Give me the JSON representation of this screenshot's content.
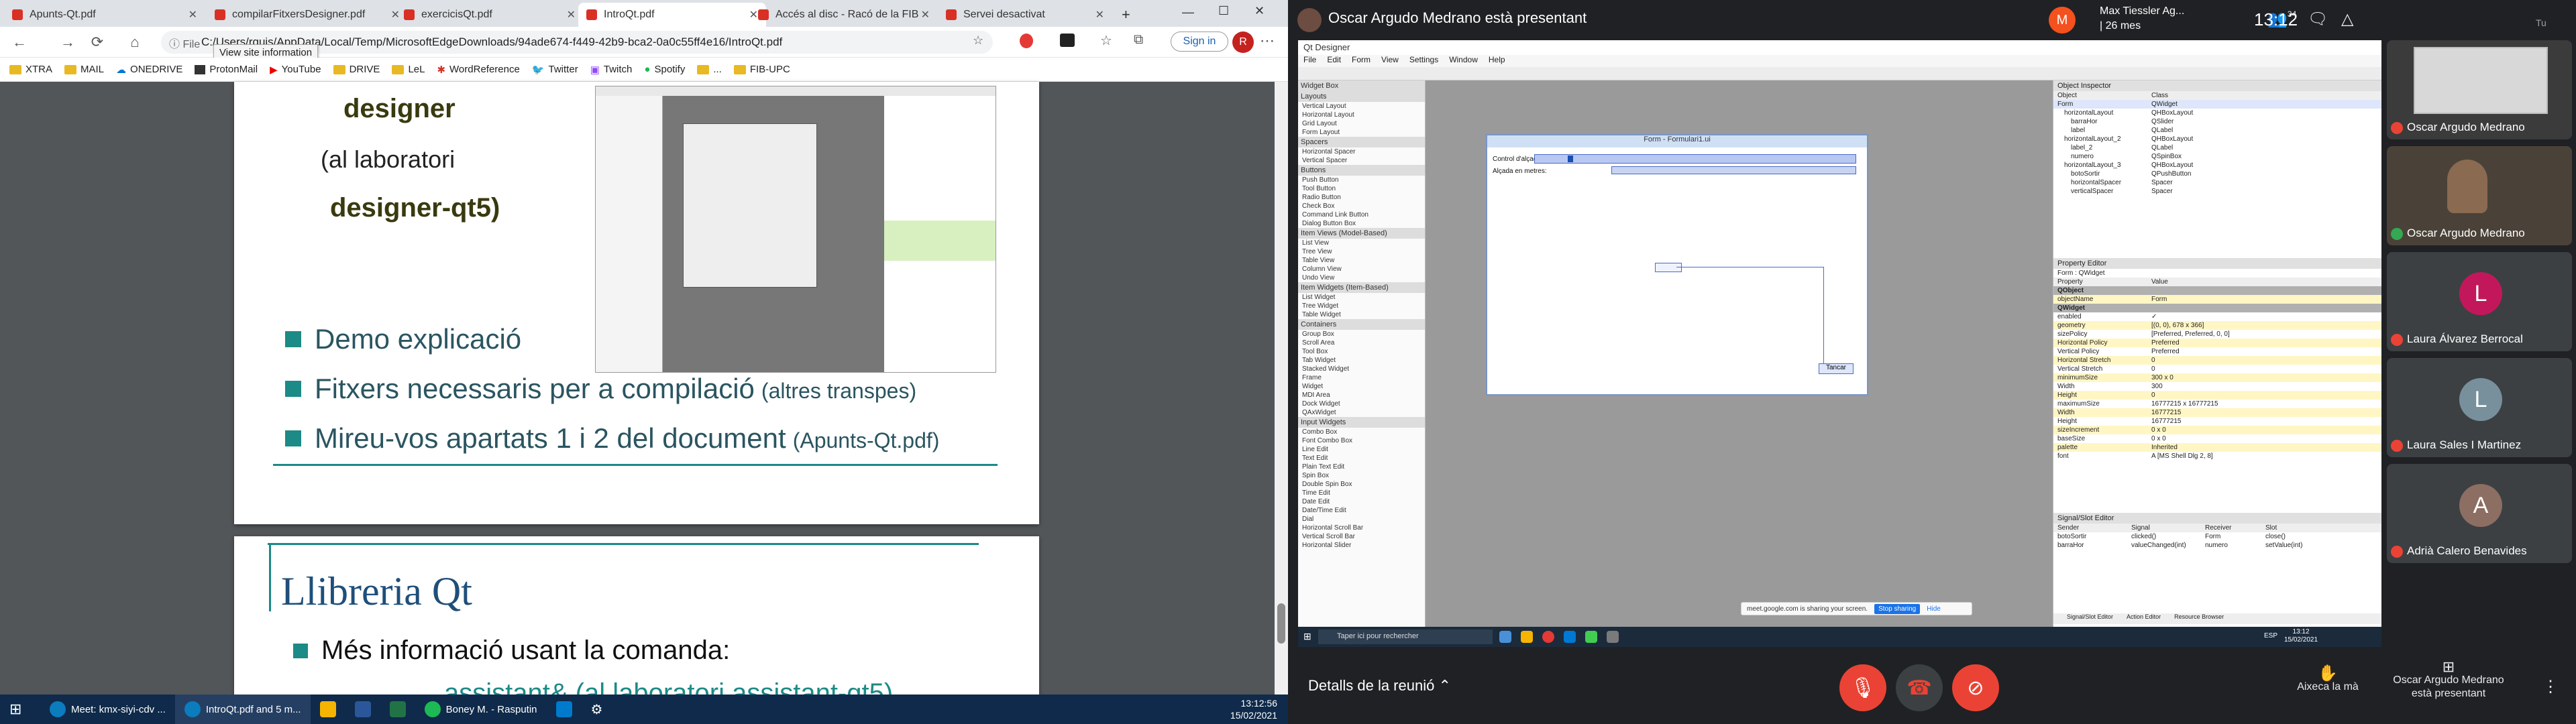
{
  "edge": {
    "tabs": [
      {
        "label": "Apunts-Qt.pdf",
        "color": "#d93025"
      },
      {
        "label": "compilarFitxersDesigner.pdf",
        "color": "#d93025"
      },
      {
        "label": "exercicisQt.pdf",
        "color": "#d93025"
      },
      {
        "label": "IntroQt.pdf",
        "color": "#d93025"
      },
      {
        "label": "Accés al disc - Racó de la FIB",
        "color": "#d93025"
      },
      {
        "label": "Servei desactivat",
        "color": "#d93025"
      }
    ],
    "new_tab": "+",
    "nav": {
      "back": "←",
      "forward": "→",
      "reload": "⟳",
      "home": "⌂"
    },
    "file_label": "File",
    "url": "C:/Users/rquis/AppData/Local/Temp/MicrosoftEdgeDownloads/94ade674-f449-42b9-bca2-0a0c55ff4e16/IntroQt.pdf",
    "tooltip": "View site information",
    "sign_in": "Sign in",
    "avatar_letter": "R",
    "bookmarks": [
      "XTRA",
      "MAIL",
      "ONEDRIVE",
      "ProtonMail",
      "YouTube",
      "DRIVE",
      "LeL",
      "WordReference",
      "Twitter",
      "Twitch",
      "Spotify",
      "...",
      "FIB-UPC"
    ]
  },
  "pdf": {
    "designer": "designer",
    "lab": "(al laboratori",
    "designer_qt5": "designer-qt5)",
    "bullets": [
      {
        "main": "Demo explicació",
        "extra": ""
      },
      {
        "main": "Fitxers necessaris per a compilació",
        "extra": "(altres transpes)"
      },
      {
        "main": "Mireu-vos apartats 1 i 2 del document",
        "extra": "(Apunts-Qt.pdf)"
      }
    ],
    "page2_title": "Llibreria Qt",
    "page2_bullet": "Més informació usant la comanda:",
    "page2_partial": "assistant&  (al laboratori assistant-qt5)"
  },
  "left_taskbar": {
    "items": [
      "Meet: kmx-siyi-cdv ...",
      "IntroQt.pdf and 5 m...",
      "",
      "",
      "",
      "Boney M. - Rasputin",
      "",
      ""
    ],
    "time": "13:12:56",
    "date": "15/02/2021"
  },
  "meet": {
    "presenter": "Oscar Argudo Medrano està presentant",
    "notif_avatar": "M",
    "notif_name": "Max Tiessler Ag...",
    "notif_time": "| 26 mes",
    "people_count": "34",
    "clock": "13:12",
    "you_label": "Tu",
    "participants": [
      {
        "name": "Oscar Argudo Medrano",
        "letter": "",
        "color": "#3b3b3b"
      },
      {
        "name": "Oscar Argudo Medrano",
        "letter": "",
        "color": "#4a4238"
      },
      {
        "name": "Laura Álvarez Berrocal",
        "letter": "L",
        "color": "#c2185b"
      },
      {
        "name": "Laura Sales I Martinez",
        "letter": "L",
        "color": "#78909c"
      },
      {
        "name": "Adrià Calero Benavides",
        "letter": "A",
        "color": "#8d6e63"
      }
    ],
    "details": "Detalls de la reunió",
    "raise_hand": "Aixeca la mà",
    "presenting_label": "Oscar Argudo Medrano està presentant"
  },
  "qt": {
    "title": "Qt Designer",
    "menu": [
      "File",
      "Edit",
      "Form",
      "View",
      "Settings",
      "Window",
      "Help"
    ],
    "widget_box_title": "Widget Box",
    "widget_sections": [
      {
        "header": "Layouts",
        "items": [
          "Vertical Layout",
          "Horizontal Layout",
          "Grid Layout",
          "Form Layout"
        ]
      },
      {
        "header": "Spacers",
        "items": [
          "Horizontal Spacer",
          "Vertical Spacer"
        ]
      },
      {
        "header": "Buttons",
        "items": [
          "Push Button",
          "Tool Button",
          "Radio Button",
          "Check Box",
          "Command Link Button",
          "Dialog Button Box"
        ]
      },
      {
        "header": "Item Views (Model-Based)",
        "items": [
          "List View",
          "Tree View",
          "Table View",
          "Column View",
          "Undo View"
        ]
      },
      {
        "header": "Item Widgets (Item-Based)",
        "items": [
          "List Widget",
          "Tree Widget",
          "Table Widget"
        ]
      },
      {
        "header": "Containers",
        "items": [
          "Group Box",
          "Scroll Area",
          "Tool Box",
          "Tab Widget",
          "Stacked Widget",
          "Frame",
          "Widget",
          "MDI Area",
          "Dock Widget",
          "QAxWidget"
        ]
      },
      {
        "header": "Input Widgets",
        "items": [
          "Combo Box",
          "Font Combo Box",
          "Line Edit",
          "Text Edit",
          "Plain Text Edit",
          "Spin Box",
          "Double Spin Box",
          "Time Edit",
          "Date Edit",
          "Date/Time Edit",
          "Dial",
          "Horizontal Scroll Bar",
          "Vertical Scroll Bar",
          "Horizontal Slider"
        ]
      }
    ],
    "form_title": "Form - Formulari1.ui",
    "form_labels": [
      "Control d'alçada",
      "Alçada en metres:"
    ],
    "form_button": "Tancar",
    "object_inspector": "Object Inspector",
    "oi_headers": [
      "Object",
      "Class"
    ],
    "oi_rows": [
      [
        "Form",
        "QWidget"
      ],
      [
        "horizontalLayout",
        "QHBoxLayout"
      ],
      [
        "barraHor",
        "QSlider"
      ],
      [
        "label",
        "QLabel"
      ],
      [
        "horizontalLayout_2",
        "QHBoxLayout"
      ],
      [
        "label_2",
        "QLabel"
      ],
      [
        "numero",
        "QSpinBox"
      ],
      [
        "horizontalLayout_3",
        "QHBoxLayout"
      ],
      [
        "botoSortir",
        "QPushButton"
      ],
      [
        "horizontalSpacer",
        "Spacer"
      ],
      [
        "verticalSpacer",
        "Spacer"
      ]
    ],
    "property_editor": "Property Editor",
    "pe_filter": "Form : QWidget",
    "pe_headers": [
      "Property",
      "Value"
    ],
    "pe_rows": [
      [
        "QObject",
        ""
      ],
      [
        "objectName",
        "Form"
      ],
      [
        "QWidget",
        ""
      ],
      [
        "enabled",
        "✓"
      ],
      [
        "geometry",
        "[(0, 0), 678 x 366]"
      ],
      [
        "sizePolicy",
        "[Preferred, Preferred, 0, 0]"
      ],
      [
        "Horizontal Policy",
        "Preferred"
      ],
      [
        "Vertical Policy",
        "Preferred"
      ],
      [
        "Horizontal Stretch",
        "0"
      ],
      [
        "Vertical Stretch",
        "0"
      ],
      [
        "minimumSize",
        "300 x 0"
      ],
      [
        "Width",
        "300"
      ],
      [
        "Height",
        "0"
      ],
      [
        "maximumSize",
        "16777215 x 16777215"
      ],
      [
        "Width",
        "16777215"
      ],
      [
        "Height",
        "16777215"
      ],
      [
        "sizeIncrement",
        "0 x 0"
      ],
      [
        "baseSize",
        "0 x 0"
      ],
      [
        "palette",
        "Inherited"
      ],
      [
        "font",
        "A [MS Shell Dlg 2, 8]"
      ]
    ],
    "signal_editor": "Signal/Slot Editor",
    "se_headers": [
      "Sender",
      "Signal",
      "Receiver",
      "Slot"
    ],
    "se_rows": [
      [
        "botoSortir",
        "clicked()",
        "Form",
        "close()"
      ],
      [
        "barraHor",
        "valueChanged(int)",
        "numero",
        "setValue(int)"
      ]
    ],
    "bottom_tabs": [
      "Signal/Slot Editor",
      "Action Editor",
      "Resource Browser"
    ],
    "share_text": "meet.google.com is sharing your screen.",
    "stop_sharing": "Stop sharing",
    "hide": "Hide",
    "win_search": "Taper ici pour rechercher",
    "win_time": "13:12",
    "win_date": "15/02/2021",
    "win_lang": "ESP"
  }
}
